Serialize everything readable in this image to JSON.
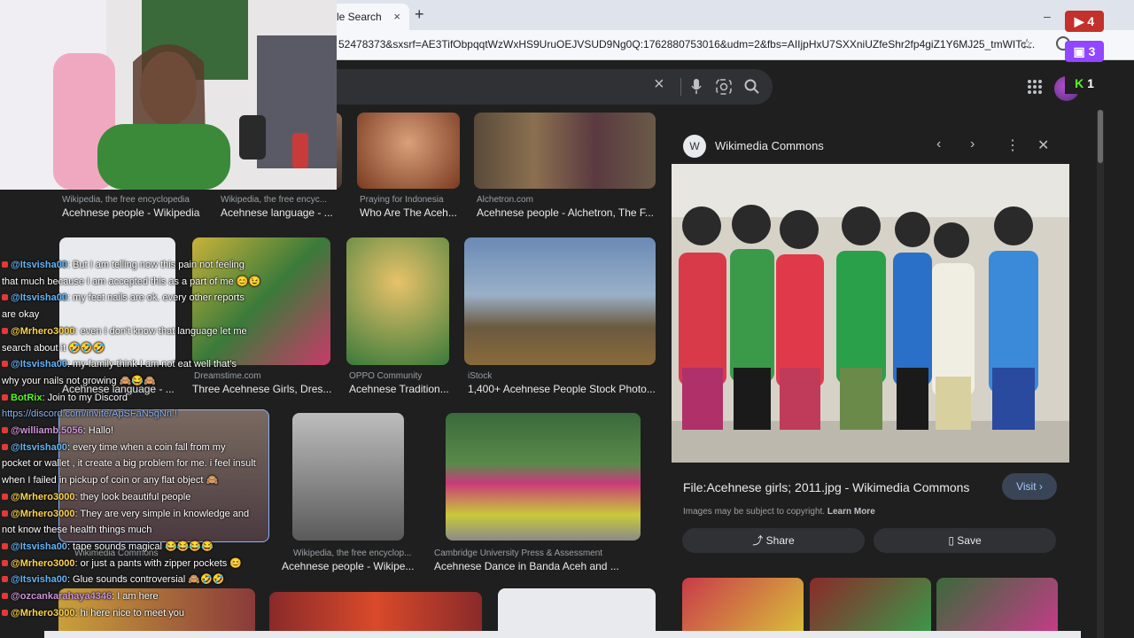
{
  "browser": {
    "tab_title": "le Search",
    "tab_close": "×",
    "new_tab": "+",
    "minimize": "–",
    "url": "52478373&sxsrf=AE3TifObpqqtWzWxHS9UruOEJVSUD9Ng0Q:1762880753016&udm=2&fbs=AIIjpHxU7SXXniUZfeShr2fp4giZ1Y6MJ25_tmWITc..."
  },
  "search": {
    "clear_icon": "×",
    "mic_icon": "mic",
    "lens_icon": "lens",
    "search_icon": "search"
  },
  "results": [
    {
      "source": "Wikipedia, the free encyclopedia",
      "title": "Acehnese people - Wikipedia"
    },
    {
      "source": "Wikipedia, the free encyc...",
      "title": "Acehnese language - ..."
    },
    {
      "source": "Praying for Indonesia",
      "title": "Who Are The Aceh..."
    },
    {
      "source": "Alchetron.com",
      "title": "Acehnese people - Alchetron, The F..."
    },
    {
      "source": "",
      "title": "Acehnese language - ..."
    },
    {
      "source": "Dreamstime.com",
      "title": "Three Acehnese Girls, Dres..."
    },
    {
      "source": "OPPO Community",
      "title": "Acehnese Tradition..."
    },
    {
      "source": "iStock",
      "title": "1,400+ Acehnese People Stock Photo..."
    },
    {
      "source": "Wikimedia Commons",
      "title": ""
    },
    {
      "source": "Wikipedia, the free encyclop...",
      "title": "Acehnese people - Wikipe..."
    },
    {
      "source": "Cambridge University Press & Assessment",
      "title": "Acehnese Dance in Banda Aceh and ..."
    }
  ],
  "panel": {
    "source": "Wikimedia Commons",
    "title": "File:Acehnese girls; 2011.jpg - Wikimedia Commons",
    "visit": "Visit ›",
    "copyright": "Images may be subject to copyright.",
    "learn_more": "Learn More",
    "share": "Share",
    "save": "Save"
  },
  "stream": {
    "social_1": "4",
    "social_2": "3",
    "social_3": "1"
  },
  "chat": [
    {
      "user": "@Itsvisha00",
      "text": ": But I am telling now this pain not feeling"
    },
    {
      "user": "",
      "text": "that much because I am accepted this as a part of me 😊😉"
    },
    {
      "user": "@Itsvisha00",
      "text": ": my feet nails are ok. every other reports"
    },
    {
      "user": "",
      "text": "are okay"
    },
    {
      "user": "@Mrhero3000",
      "text": ": even I don't know that language let me"
    },
    {
      "user": "",
      "text": "search about it 🤣🤣🤣"
    },
    {
      "user": "@Itsvisha00",
      "text": ": my family think I am not eat well that's"
    },
    {
      "user": "",
      "text": "why your nails not growing 🙈😂🙈"
    },
    {
      "user": "BotRix",
      "text": ": Join to my Discord"
    },
    {
      "user": "",
      "text": "https://discord.com/invite/ApSFaN5gNn !"
    },
    {
      "user": "@williamb.5056",
      "text": ": Hallo!"
    },
    {
      "user": "@Itsvisha00",
      "text": ": every time when a coin fall from my"
    },
    {
      "user": "",
      "text": "pocket or wallet , it create a big problem for me. i feel insult"
    },
    {
      "user": "",
      "text": "when I failed in pickup of coin or any flat object 🙈"
    },
    {
      "user": "@Mrhero3000",
      "text": ": they look beautiful people"
    },
    {
      "user": "@Mrhero3000",
      "text": ": They are very simple in knowledge and"
    },
    {
      "user": "",
      "text": "not know these health things much"
    },
    {
      "user": "@Itsvisha00",
      "text": ": tape sounds magical 😂😂😂😂"
    },
    {
      "user": "@Mrhero3000",
      "text": ": or just a pants with zipper pockets 😊"
    },
    {
      "user": "@Itsvisha00",
      "text": ": Glue sounds controversial 🙈🤣🤣"
    },
    {
      "user": "@ozcankarahaya4346",
      "text": ": I am here"
    },
    {
      "user": "@Mrhero3000",
      "text": ": hi here nice to meet you"
    }
  ]
}
